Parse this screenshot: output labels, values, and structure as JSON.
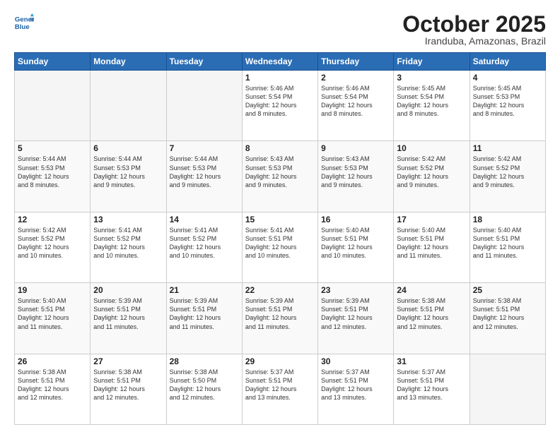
{
  "logo": {
    "line1": "General",
    "line2": "Blue"
  },
  "header": {
    "month": "October 2025",
    "location": "Iranduba, Amazonas, Brazil"
  },
  "days_of_week": [
    "Sunday",
    "Monday",
    "Tuesday",
    "Wednesday",
    "Thursday",
    "Friday",
    "Saturday"
  ],
  "weeks": [
    [
      {
        "day": "",
        "info": ""
      },
      {
        "day": "",
        "info": ""
      },
      {
        "day": "",
        "info": ""
      },
      {
        "day": "1",
        "info": "Sunrise: 5:46 AM\nSunset: 5:54 PM\nDaylight: 12 hours\nand 8 minutes."
      },
      {
        "day": "2",
        "info": "Sunrise: 5:46 AM\nSunset: 5:54 PM\nDaylight: 12 hours\nand 8 minutes."
      },
      {
        "day": "3",
        "info": "Sunrise: 5:45 AM\nSunset: 5:54 PM\nDaylight: 12 hours\nand 8 minutes."
      },
      {
        "day": "4",
        "info": "Sunrise: 5:45 AM\nSunset: 5:53 PM\nDaylight: 12 hours\nand 8 minutes."
      }
    ],
    [
      {
        "day": "5",
        "info": "Sunrise: 5:44 AM\nSunset: 5:53 PM\nDaylight: 12 hours\nand 8 minutes."
      },
      {
        "day": "6",
        "info": "Sunrise: 5:44 AM\nSunset: 5:53 PM\nDaylight: 12 hours\nand 9 minutes."
      },
      {
        "day": "7",
        "info": "Sunrise: 5:44 AM\nSunset: 5:53 PM\nDaylight: 12 hours\nand 9 minutes."
      },
      {
        "day": "8",
        "info": "Sunrise: 5:43 AM\nSunset: 5:53 PM\nDaylight: 12 hours\nand 9 minutes."
      },
      {
        "day": "9",
        "info": "Sunrise: 5:43 AM\nSunset: 5:53 PM\nDaylight: 12 hours\nand 9 minutes."
      },
      {
        "day": "10",
        "info": "Sunrise: 5:42 AM\nSunset: 5:52 PM\nDaylight: 12 hours\nand 9 minutes."
      },
      {
        "day": "11",
        "info": "Sunrise: 5:42 AM\nSunset: 5:52 PM\nDaylight: 12 hours\nand 9 minutes."
      }
    ],
    [
      {
        "day": "12",
        "info": "Sunrise: 5:42 AM\nSunset: 5:52 PM\nDaylight: 12 hours\nand 10 minutes."
      },
      {
        "day": "13",
        "info": "Sunrise: 5:41 AM\nSunset: 5:52 PM\nDaylight: 12 hours\nand 10 minutes."
      },
      {
        "day": "14",
        "info": "Sunrise: 5:41 AM\nSunset: 5:52 PM\nDaylight: 12 hours\nand 10 minutes."
      },
      {
        "day": "15",
        "info": "Sunrise: 5:41 AM\nSunset: 5:51 PM\nDaylight: 12 hours\nand 10 minutes."
      },
      {
        "day": "16",
        "info": "Sunrise: 5:40 AM\nSunset: 5:51 PM\nDaylight: 12 hours\nand 10 minutes."
      },
      {
        "day": "17",
        "info": "Sunrise: 5:40 AM\nSunset: 5:51 PM\nDaylight: 12 hours\nand 11 minutes."
      },
      {
        "day": "18",
        "info": "Sunrise: 5:40 AM\nSunset: 5:51 PM\nDaylight: 12 hours\nand 11 minutes."
      }
    ],
    [
      {
        "day": "19",
        "info": "Sunrise: 5:40 AM\nSunset: 5:51 PM\nDaylight: 12 hours\nand 11 minutes."
      },
      {
        "day": "20",
        "info": "Sunrise: 5:39 AM\nSunset: 5:51 PM\nDaylight: 12 hours\nand 11 minutes."
      },
      {
        "day": "21",
        "info": "Sunrise: 5:39 AM\nSunset: 5:51 PM\nDaylight: 12 hours\nand 11 minutes."
      },
      {
        "day": "22",
        "info": "Sunrise: 5:39 AM\nSunset: 5:51 PM\nDaylight: 12 hours\nand 11 minutes."
      },
      {
        "day": "23",
        "info": "Sunrise: 5:39 AM\nSunset: 5:51 PM\nDaylight: 12 hours\nand 12 minutes."
      },
      {
        "day": "24",
        "info": "Sunrise: 5:38 AM\nSunset: 5:51 PM\nDaylight: 12 hours\nand 12 minutes."
      },
      {
        "day": "25",
        "info": "Sunrise: 5:38 AM\nSunset: 5:51 PM\nDaylight: 12 hours\nand 12 minutes."
      }
    ],
    [
      {
        "day": "26",
        "info": "Sunrise: 5:38 AM\nSunset: 5:51 PM\nDaylight: 12 hours\nand 12 minutes."
      },
      {
        "day": "27",
        "info": "Sunrise: 5:38 AM\nSunset: 5:51 PM\nDaylight: 12 hours\nand 12 minutes."
      },
      {
        "day": "28",
        "info": "Sunrise: 5:38 AM\nSunset: 5:50 PM\nDaylight: 12 hours\nand 12 minutes."
      },
      {
        "day": "29",
        "info": "Sunrise: 5:37 AM\nSunset: 5:51 PM\nDaylight: 12 hours\nand 13 minutes."
      },
      {
        "day": "30",
        "info": "Sunrise: 5:37 AM\nSunset: 5:51 PM\nDaylight: 12 hours\nand 13 minutes."
      },
      {
        "day": "31",
        "info": "Sunrise: 5:37 AM\nSunset: 5:51 PM\nDaylight: 12 hours\nand 13 minutes."
      },
      {
        "day": "",
        "info": ""
      }
    ]
  ]
}
